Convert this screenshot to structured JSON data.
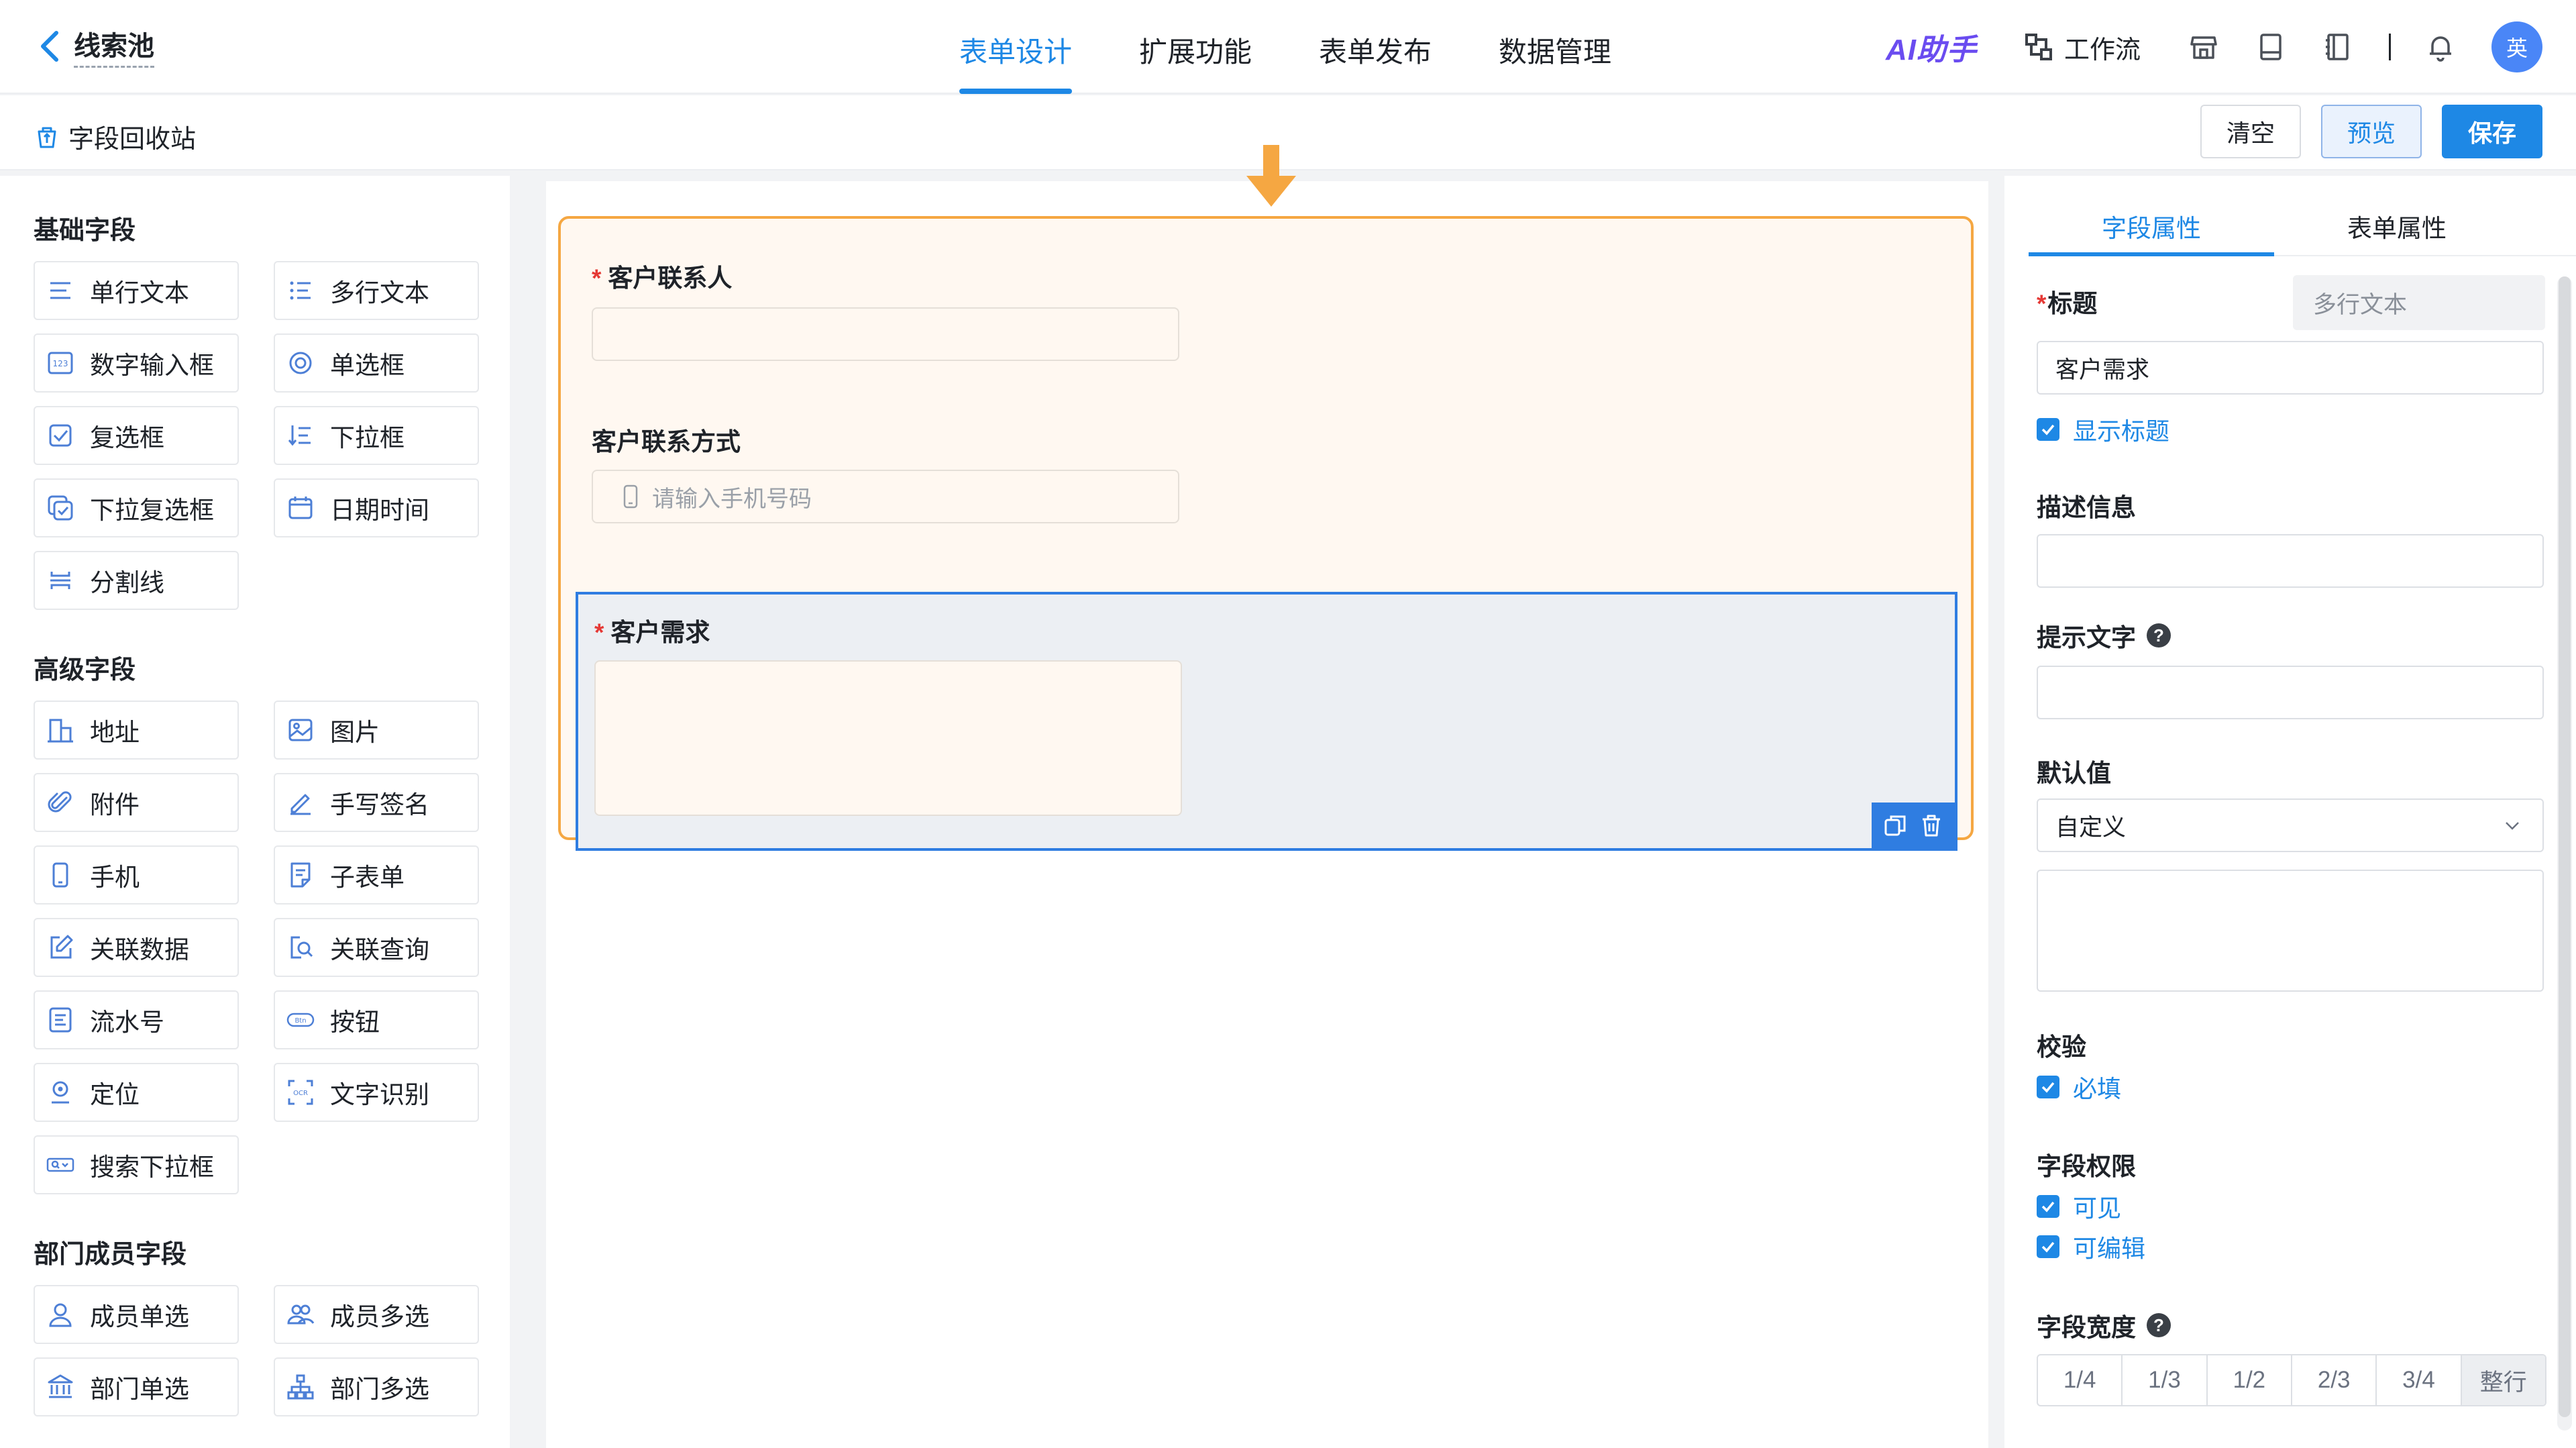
{
  "header": {
    "back_title": "线索池",
    "tabs": [
      "表单设计",
      "扩展功能",
      "表单发布",
      "数据管理"
    ],
    "active_tab": "表单设计",
    "ai_label": "AI助手",
    "workflow_label": "工作流",
    "avatar_text": "英"
  },
  "subbar": {
    "recycle_label": "字段回收站",
    "clear_label": "清空",
    "preview_label": "预览",
    "save_label": "保存"
  },
  "palette": {
    "basic_title": "基础字段",
    "basic_items": [
      {
        "label": "单行文本",
        "icon": "single-line-icon"
      },
      {
        "label": "多行文本",
        "icon": "multi-line-icon"
      },
      {
        "label": "数字输入框",
        "icon": "number-icon"
      },
      {
        "label": "单选框",
        "icon": "radio-icon"
      },
      {
        "label": "复选框",
        "icon": "checkbox-icon"
      },
      {
        "label": "下拉框",
        "icon": "dropdown-icon"
      },
      {
        "label": "下拉复选框",
        "icon": "dropdown-checkbox-icon"
      },
      {
        "label": "日期时间",
        "icon": "calendar-icon"
      },
      {
        "label": "分割线",
        "icon": "divider-icon"
      }
    ],
    "advanced_title": "高级字段",
    "advanced_items": [
      {
        "label": "地址",
        "icon": "address-icon"
      },
      {
        "label": "图片",
        "icon": "image-icon"
      },
      {
        "label": "附件",
        "icon": "attachment-icon"
      },
      {
        "label": "手写签名",
        "icon": "signature-icon"
      },
      {
        "label": "手机",
        "icon": "phone-icon"
      },
      {
        "label": "子表单",
        "icon": "subform-icon"
      },
      {
        "label": "关联数据",
        "icon": "link-data-icon"
      },
      {
        "label": "关联查询",
        "icon": "link-query-icon"
      },
      {
        "label": "流水号",
        "icon": "serial-number-icon"
      },
      {
        "label": "按钮",
        "icon": "button-icon"
      },
      {
        "label": "定位",
        "icon": "location-icon"
      },
      {
        "label": "文字识别",
        "icon": "ocr-icon"
      },
      {
        "label": "搜索下拉框",
        "icon": "search-dropdown-icon"
      }
    ],
    "member_title": "部门成员字段",
    "member_items": [
      {
        "label": "成员单选",
        "icon": "member-single-icon"
      },
      {
        "label": "成员多选",
        "icon": "member-multi-icon"
      },
      {
        "label": "部门单选",
        "icon": "department-single-icon"
      },
      {
        "label": "部门多选",
        "icon": "department-multi-icon"
      }
    ]
  },
  "canvas": {
    "fields": [
      {
        "label": "客户联系人",
        "required": "*",
        "placeholder": ""
      },
      {
        "label": "客户联系方式",
        "required": "",
        "placeholder": "请输入手机号码"
      },
      {
        "label": "客户需求",
        "required": "*",
        "placeholder": ""
      }
    ]
  },
  "properties": {
    "tabs": [
      "字段属性",
      "表单属性"
    ],
    "active_tab": "字段属性",
    "title_label": "标题",
    "title_required": "*",
    "field_type": "多行文本",
    "title_value": "客户需求",
    "show_title_label": "显示标题",
    "desc_label": "描述信息",
    "desc_value": "",
    "hint_label": "提示文字",
    "hint_value": "",
    "default_label": "默认值",
    "default_mode": "自定义",
    "default_value": "",
    "validation_label": "校验",
    "required_label": "必填",
    "permission_label": "字段权限",
    "visible_label": "可见",
    "editable_label": "可编辑",
    "width_label": "字段宽度",
    "width_options": [
      "1/4",
      "1/3",
      "1/2",
      "2/3",
      "3/4",
      "整行"
    ],
    "width_selected": "整行"
  },
  "colors": {
    "accent": "#1e88e5",
    "form_border": "#f5a742",
    "drop_arrow": "#f5a742",
    "selected_border": "#2f7de1",
    "required": "#e53935"
  }
}
